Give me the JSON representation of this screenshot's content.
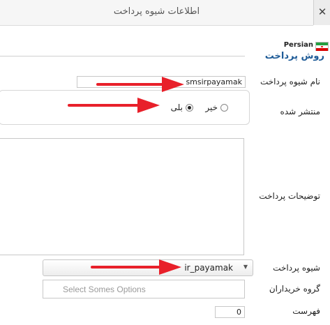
{
  "header": {
    "title": "اطلاعات شیوه پرداخت",
    "close_glyph": "✕"
  },
  "language": {
    "label": "Persian",
    "flag_icon": "iran-flag-icon"
  },
  "section": {
    "legend": "روش پرداخت"
  },
  "form": {
    "method_name": {
      "label": "نام شیوه پرداخت",
      "value": "smsirpayamak"
    },
    "published": {
      "label": "منتشر شده",
      "options": [
        {
          "label": "خیر",
          "selected": false
        },
        {
          "label": "بلی",
          "selected": true
        }
      ]
    },
    "description": {
      "label": "توضیحات پرداخت",
      "value": ""
    },
    "payment_method": {
      "label": "شیوه پرداخت",
      "selected": "ir_payamak"
    },
    "shopper_groups": {
      "label": "گروه خریداران",
      "placeholder": "Select Somes Options"
    },
    "order": {
      "label": "فهرست",
      "value": "0"
    }
  },
  "colors": {
    "arrow": "#e8202a",
    "legend": "#1e5b97"
  }
}
